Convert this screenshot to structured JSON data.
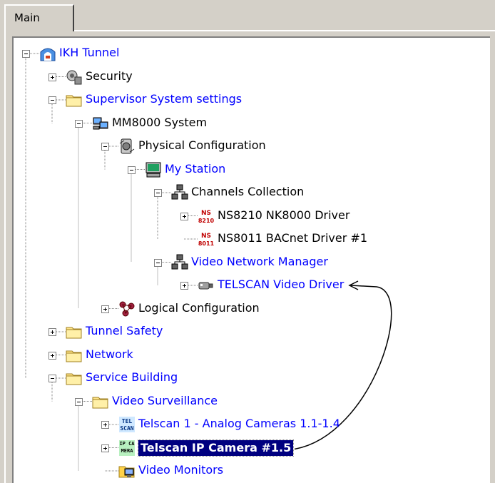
{
  "tab": {
    "label": "Main"
  },
  "tree": [
    {
      "id": "ikh",
      "label": "IKH Tunnel",
      "level": 0,
      "expander": "minus",
      "icon": "tunnel-icon",
      "color": "blue"
    },
    {
      "id": "security",
      "label": "Security",
      "level": 1,
      "expander": "plus",
      "icon": "security-icon",
      "color": "black"
    },
    {
      "id": "supervisor",
      "label": "Supervisor System settings",
      "level": 1,
      "expander": "minus",
      "icon": "folder-icon",
      "color": "blue"
    },
    {
      "id": "mm8000",
      "label": "MM8000 System",
      "level": 2,
      "expander": "minus",
      "icon": "system-icon",
      "color": "black"
    },
    {
      "id": "physical",
      "label": "Physical Configuration",
      "level": 3,
      "expander": "minus",
      "icon": "physical-config-icon",
      "color": "black"
    },
    {
      "id": "mystation",
      "label": "My Station",
      "level": 4,
      "expander": "minus",
      "icon": "station-icon",
      "color": "blue"
    },
    {
      "id": "channels",
      "label": "Channels Collection",
      "level": 5,
      "expander": "minus",
      "icon": "network-icon",
      "color": "black"
    },
    {
      "id": "ns8210",
      "label": "NS8210 NK8000 Driver",
      "level": 6,
      "expander": "plus",
      "icon": "driver-icon",
      "color": "black",
      "icon_text": "NS 8210"
    },
    {
      "id": "ns8011",
      "label": "NS8011 BACnet Driver #1",
      "level": 6,
      "expander": "none",
      "icon": "driver-icon",
      "color": "black",
      "icon_text": "NS 8011"
    },
    {
      "id": "videonet",
      "label": "Video Network Manager",
      "level": 5,
      "expander": "minus",
      "icon": "network-icon",
      "color": "blue"
    },
    {
      "id": "telscandrv",
      "label": "TELSCAN Video Driver",
      "level": 6,
      "expander": "plus",
      "icon": "camera-icon",
      "color": "blue"
    },
    {
      "id": "logical",
      "label": "Logical Configuration",
      "level": 3,
      "expander": "plus",
      "icon": "logical-config-icon",
      "color": "black"
    },
    {
      "id": "tunnelsafety",
      "label": "Tunnel Safety",
      "level": 1,
      "expander": "plus",
      "icon": "folder-icon",
      "color": "blue"
    },
    {
      "id": "network",
      "label": "Network",
      "level": 1,
      "expander": "plus",
      "icon": "folder-icon",
      "color": "blue"
    },
    {
      "id": "servicebuilding",
      "label": "Service Building",
      "level": 1,
      "expander": "minus",
      "icon": "folder-icon",
      "color": "blue"
    },
    {
      "id": "videosurv",
      "label": "Video Surveillance",
      "level": 2,
      "expander": "minus",
      "icon": "folder-icon",
      "color": "blue"
    },
    {
      "id": "telscan1",
      "label": "Telscan 1 - Analog Cameras 1.1-1.4",
      "level": 3,
      "expander": "plus",
      "icon": "telscan-icon",
      "color": "blue",
      "icon_text": "TEL SCAN"
    },
    {
      "id": "telscanip",
      "label": "Telscan IP Camera  #1.5",
      "level": 3,
      "expander": "plus",
      "icon": "ip-camera-icon",
      "color": "selected",
      "icon_text": "IP CA MERA"
    },
    {
      "id": "videomon",
      "label": "Video Monitors",
      "level": 3,
      "expander": "none",
      "icon": "monitor-folder-icon",
      "color": "blue"
    }
  ],
  "colors": {
    "link": "#0000ff",
    "selected_bg": "#000080",
    "background": "#d4d0c8"
  }
}
